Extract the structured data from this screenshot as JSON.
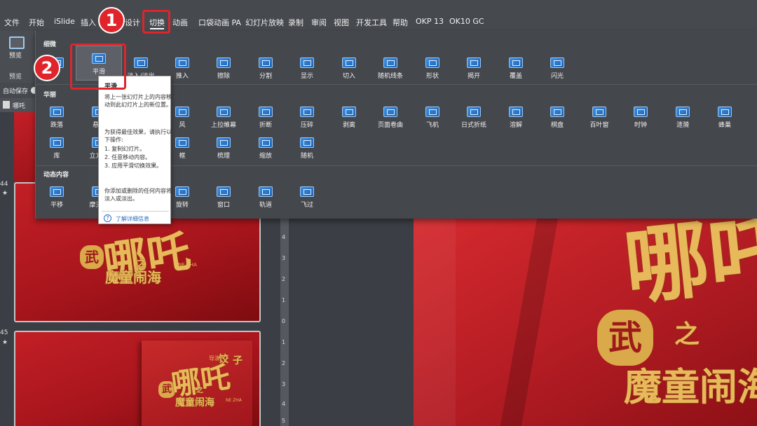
{
  "ribbon_tabs": [
    "文件",
    "开始",
    "iSlide",
    "插入",
    "设计",
    "切换",
    "动画",
    "口袋动画 PA",
    "幻灯片放映",
    "录制",
    "审阅",
    "视图",
    "开发工具",
    "帮助",
    "OKP 13",
    "OK10 GC"
  ],
  "active_tab": "切换",
  "callouts": {
    "one": "1",
    "two": "2"
  },
  "preview": {
    "button_label": "预览",
    "group_label": "预览"
  },
  "autosave_label": "自动保存",
  "file_tab_label": "哪吒",
  "gallery": {
    "sections": {
      "subtle": "细微",
      "exciting": "华丽",
      "dynamic": "动态内容"
    },
    "subtle_items": [
      "",
      "平滑",
      "淡入/淡出",
      "推入",
      "擦除",
      "分割",
      "显示",
      "切入",
      "随机线条",
      "形状",
      "揭开",
      "覆盖",
      "闪光"
    ],
    "exciting_row1": [
      "跌落",
      "悬挂",
      "",
      "",
      "风",
      "上拉帷幕",
      "折断",
      "压碎",
      "剥离",
      "页面卷曲",
      "飞机",
      "日式折纸",
      "溶解",
      "棋盘",
      "百叶窗",
      "时钟",
      "涟漪",
      "蜂巢"
    ],
    "exciting_row2": [
      "库",
      "立方体",
      "",
      "",
      "框",
      "梳理",
      "缩放",
      "随机"
    ],
    "dynamic_items": [
      "平移",
      "摩天轮",
      "",
      "",
      "旋转",
      "窗口",
      "轨道",
      "飞过"
    ]
  },
  "tooltip": {
    "title": "平滑",
    "line1": "将上一张幻灯片上的内容移动到此幻灯片上的新位置。",
    "line2": "为获得最佳效果，请执行以下操作:",
    "step1": "1. 复制幻灯片。",
    "step2": "2. 任意移动内容。",
    "step3": "3. 应用平滑切换效果。",
    "line3": "你添加或删除的任何内容将淡入或淡出。",
    "link": "了解详细信息",
    "help_icon": "?"
  },
  "slides": [
    {
      "number": "44",
      "star": "★"
    },
    {
      "number": "45",
      "star": "★"
    }
  ],
  "slide_art": {
    "title": "哪吒",
    "sub": "之",
    "tagline": "魔童闹海",
    "seal": "武",
    "latin": "NE ZHA",
    "side1": "饺",
    "side2": "子",
    "side3": "导演"
  },
  "ruler": [
    "4",
    "3",
    "2",
    "1",
    "0",
    "1",
    "2",
    "3",
    "4",
    "5"
  ]
}
